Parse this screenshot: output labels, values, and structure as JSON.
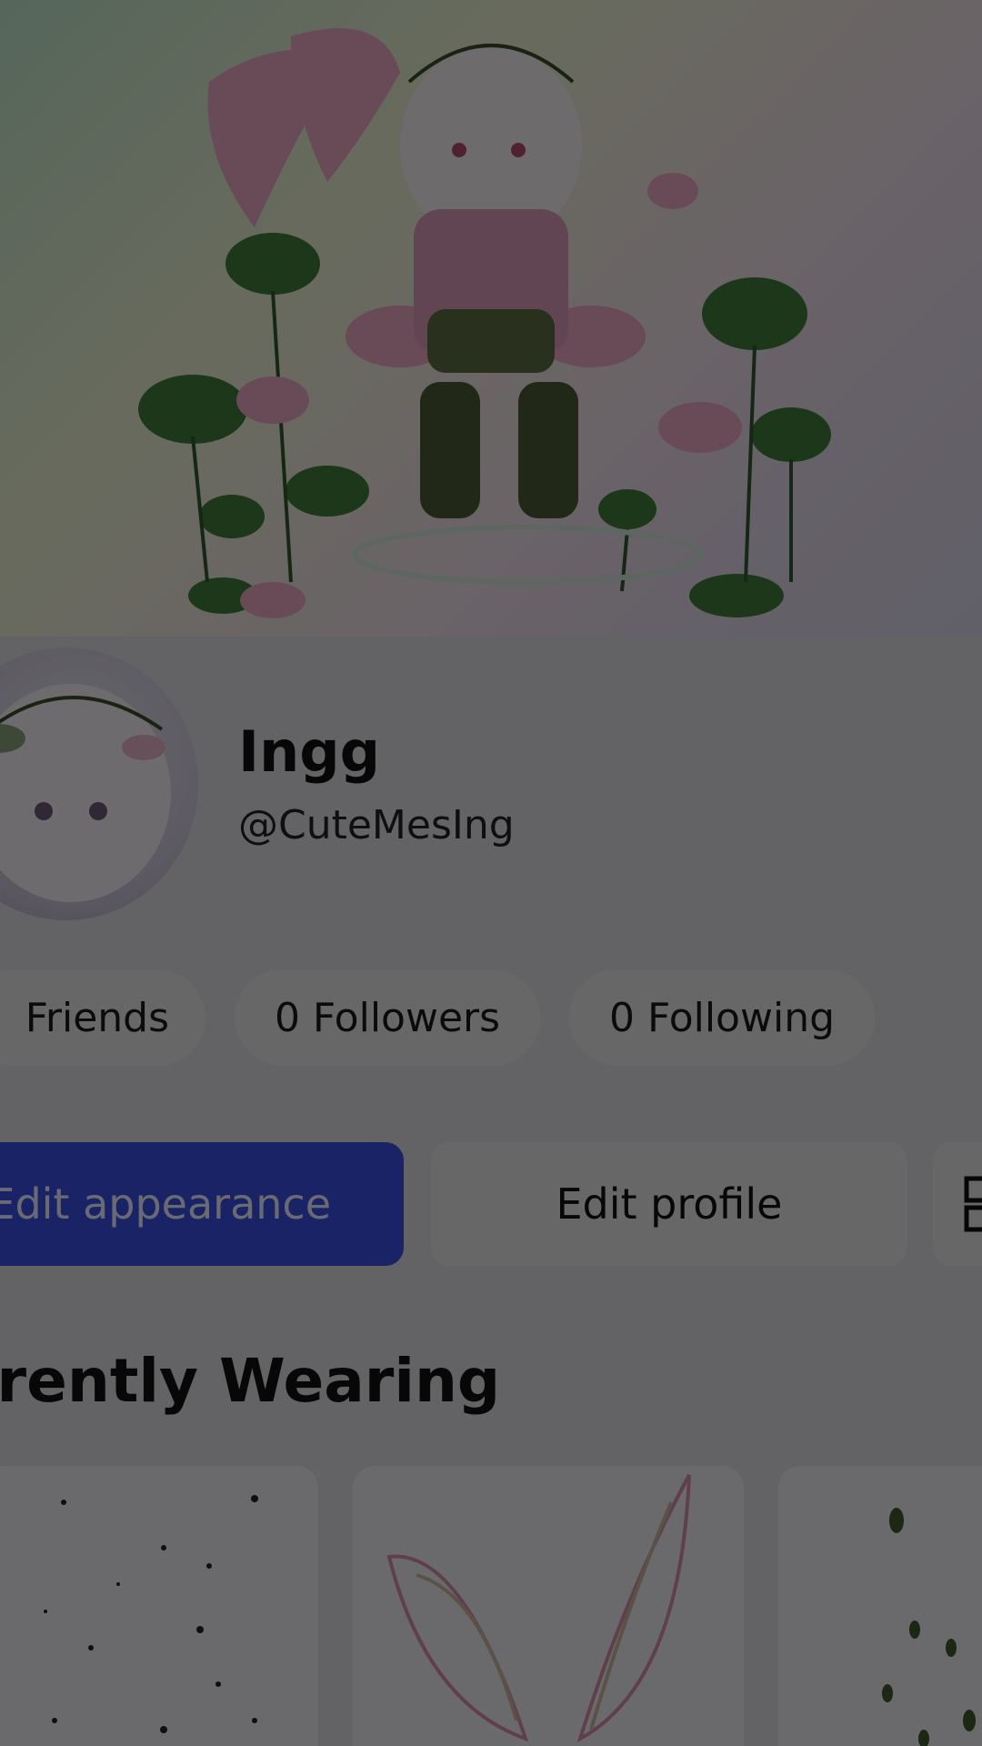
{
  "profile": {
    "display_name": "Ingg",
    "username": "@CuteMesIng"
  },
  "stats": {
    "friends_label": "Friends",
    "followers_label": "0 Followers",
    "following_label": "0 Following"
  },
  "actions": {
    "edit_appearance_label": "Edit appearance",
    "edit_profile_label": "Edit profile",
    "more_icon": "grid-icon"
  },
  "currently_wearing": {
    "title": "rrently Wearing"
  },
  "colors": {
    "primary_button": "#3a4fe0",
    "pill_background": "#e4e4e7"
  }
}
